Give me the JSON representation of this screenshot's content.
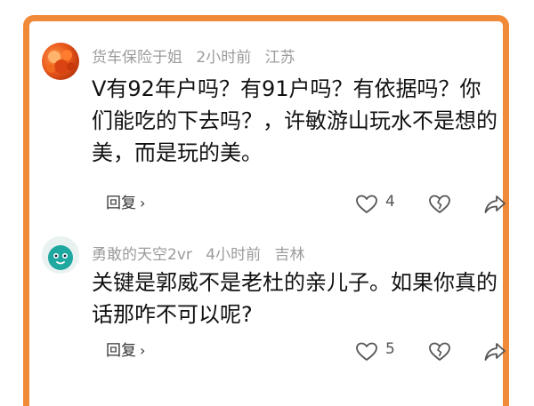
{
  "comments": [
    {
      "username": "货车保险于姐",
      "time": "2小时前",
      "location": "江苏",
      "text": "V有92年户吗？有91户吗？有依据吗？你们能吃的下去吗？，许敏游山玩水不是想的美，而是玩的美。",
      "reply_label": "回复",
      "like_count": "4",
      "avatar_icon": "avatar-photo"
    },
    {
      "username": "勇敢的天空2vr",
      "time": "4小时前",
      "location": "吉林",
      "text": "关键是郭威不是老杜的亲儿子。如果你真的话那咋不可以呢?",
      "reply_label": "回复",
      "like_count": "5",
      "avatar_icon": "avatar-default"
    }
  ],
  "colors": {
    "frame_border": "#f08a38",
    "meta_text": "#9b9b9b",
    "body_text": "#111111"
  }
}
